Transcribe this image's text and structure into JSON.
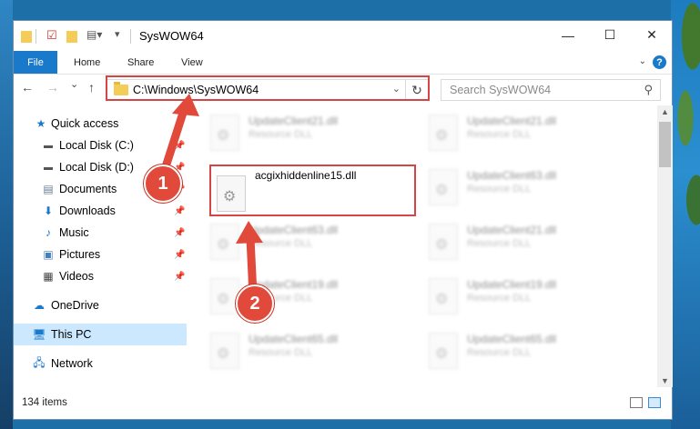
{
  "window": {
    "title": "SysWOW64",
    "controls": [
      "—",
      "☐",
      "✕"
    ]
  },
  "ribbon": {
    "tabs": [
      "File",
      "Home",
      "Share",
      "View"
    ],
    "help": "?"
  },
  "navbar": {
    "back": "←",
    "forward": "→",
    "recent": "⌄",
    "up": "↑",
    "address": "C:\\Windows\\SysWOW64",
    "search_placeholder": "Search SysWOW64"
  },
  "sidebar": {
    "items": [
      {
        "label": "Quick access",
        "icon": "star-icon",
        "pinned": false
      },
      {
        "label": "Local Disk (C:)",
        "icon": "drive-icon",
        "pinned": true
      },
      {
        "label": "Local Disk (D:)",
        "icon": "drive-icon",
        "pinned": true
      },
      {
        "label": "Documents",
        "icon": "documents-icon",
        "pinned": true
      },
      {
        "label": "Downloads",
        "icon": "download-icon",
        "pinned": true
      },
      {
        "label": "Music",
        "icon": "music-icon",
        "pinned": true
      },
      {
        "label": "Pictures",
        "icon": "pictures-icon",
        "pinned": true
      },
      {
        "label": "Videos",
        "icon": "videos-icon",
        "pinned": true
      },
      {
        "label": "OneDrive",
        "icon": "cloud-icon",
        "pinned": false
      },
      {
        "label": "This PC",
        "icon": "computer-icon",
        "pinned": false,
        "selected": true
      },
      {
        "label": "Network",
        "icon": "network-icon",
        "pinned": false
      }
    ]
  },
  "files": [
    {
      "name": "UpdateClient21.dll",
      "type": "Resource DLL"
    },
    {
      "name": "UpdateClient21.dll",
      "type": "Resource DLL"
    },
    {
      "name": "acgixhiddenline15.dll",
      "type": ""
    },
    {
      "name": "UpdateClient63.dll",
      "type": "Resource DLL"
    },
    {
      "name": "UpdateClient63.dll",
      "type": "Resource DLL"
    },
    {
      "name": "UpdateClient21.dll",
      "type": "Resource DLL"
    },
    {
      "name": "UpdateClient19.dll",
      "type": "Resource DLL"
    },
    {
      "name": "UpdateClient19.dll",
      "type": "Resource DLL"
    },
    {
      "name": "UpdateClient65.dll",
      "type": "Resource DLL"
    },
    {
      "name": "UpdateClient65.dll",
      "type": "Resource DLL"
    }
  ],
  "status": {
    "item_count": "134 items"
  },
  "annotations": {
    "step1": "1",
    "step2": "2",
    "color": "#e14a3b"
  }
}
